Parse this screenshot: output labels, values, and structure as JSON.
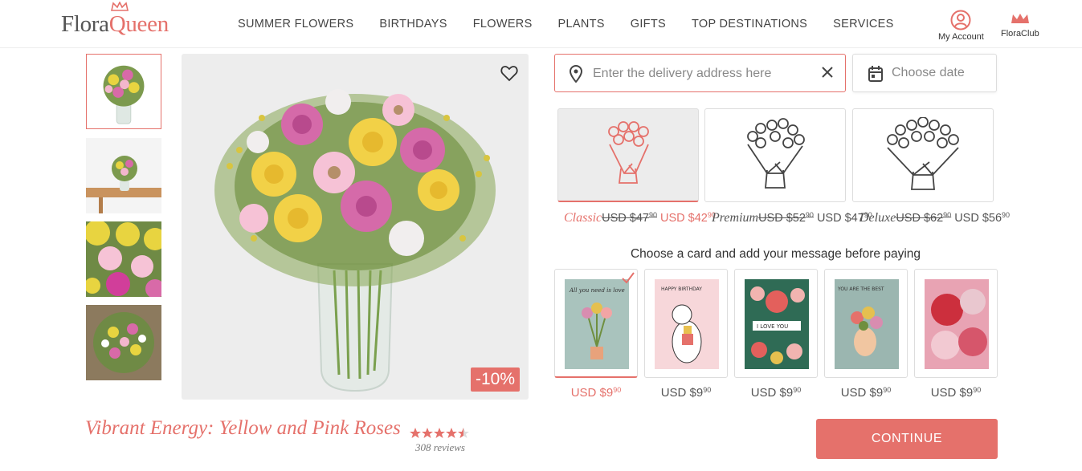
{
  "brand": {
    "name_part1": "Flora",
    "name_part2": "Queen",
    "accent": "#e5716b"
  },
  "nav": [
    "SUMMER FLOWERS",
    "BIRTHDAYS",
    "FLOWERS",
    "PLANTS",
    "GIFTS",
    "TOP DESTINATIONS",
    "SERVICES"
  ],
  "account": {
    "my_account": "My Account",
    "club": "FloraClub"
  },
  "product": {
    "title": "Vibrant Energy: Yellow and Pink Roses",
    "stars": "★★★★★",
    "rating": 4.5,
    "reviews": "308 reviews",
    "discount": "-10%"
  },
  "delivery": {
    "address_placeholder": "Enter the delivery address here",
    "date_placeholder": "Choose date"
  },
  "sizes": [
    {
      "name": "Classic",
      "old": "USD $47",
      "old_cents": "90",
      "new": "USD $42",
      "new_cents": "90"
    },
    {
      "name": "Premium",
      "old": "USD $52",
      "old_cents": "90",
      "new": "USD $47",
      "new_cents": "90"
    },
    {
      "name": "Deluxe",
      "old": "USD $62",
      "old_cents": "90",
      "new": "USD $56",
      "new_cents": "90"
    }
  ],
  "cards_heading": "Choose a card and add your message before paying",
  "cards": [
    {
      "text": "All you need is love",
      "price": "USD $9",
      "cents": "90"
    },
    {
      "text": "HAPPY BIRTHDAY",
      "price": "USD $9",
      "cents": "90"
    },
    {
      "text": "I LOVE YOU",
      "price": "USD $9",
      "cents": "90"
    },
    {
      "text": "YOU ARE THE BEST",
      "price": "USD $9",
      "cents": "90"
    },
    {
      "text": "",
      "price": "USD $9",
      "cents": "90"
    }
  ],
  "continue_label": "CONTINUE"
}
